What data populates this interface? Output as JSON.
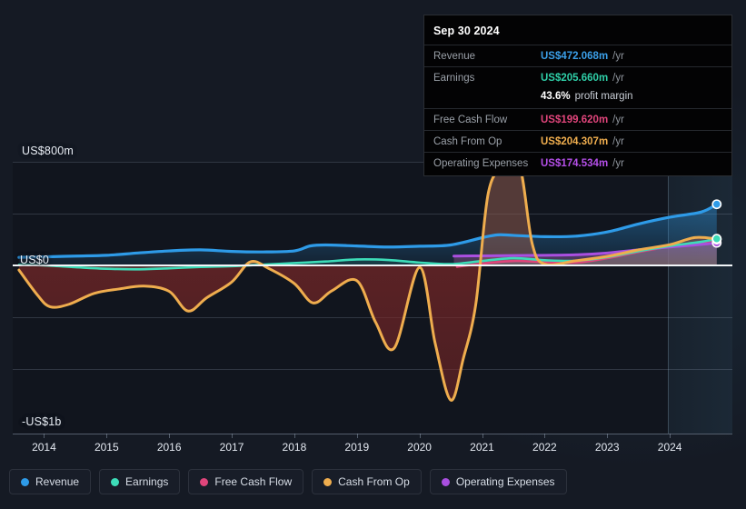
{
  "chart_data": {
    "type": "area",
    "title": "",
    "xlabel": "",
    "ylabel": "",
    "x_tick_labels": [
      "2014",
      "2015",
      "2016",
      "2017",
      "2018",
      "2019",
      "2020",
      "2021",
      "2022",
      "2023",
      "2024"
    ],
    "y_tick_labels": [
      "US$800m",
      "US$0",
      "-US$1b"
    ],
    "ylim": [
      -1150,
      900
    ],
    "xlim": [
      2013.5,
      2025.0
    ],
    "grid": true,
    "legend_position": "bottom-left",
    "currency": "USD",
    "units": "millions",
    "forecast_start_x": 2023.85,
    "series": [
      {
        "name": "Revenue",
        "color": "#2E9BE8",
        "x": [
          2013.6,
          2014.0,
          2014.5,
          2015.0,
          2015.5,
          2016.0,
          2016.5,
          2017.0,
          2017.5,
          2018.0,
          2018.25,
          2018.5,
          2019.0,
          2019.5,
          2020.0,
          2020.5,
          2021.0,
          2021.25,
          2021.5,
          2022.0,
          2022.5,
          2023.0,
          2023.5,
          2024.0,
          2024.5,
          2024.75
        ],
        "values": [
          62,
          66,
          72,
          78,
          96,
          112,
          120,
          108,
          104,
          112,
          150,
          158,
          150,
          142,
          148,
          158,
          214,
          236,
          232,
          222,
          226,
          258,
          320,
          372,
          412,
          472.068
        ]
      },
      {
        "name": "Earnings",
        "color": "#3DDCB8",
        "x": [
          2013.6,
          2014.0,
          2014.5,
          2015.0,
          2015.5,
          2016.0,
          2016.5,
          2017.0,
          2017.5,
          2018.0,
          2018.5,
          2019.0,
          2019.5,
          2020.0,
          2020.5,
          2021.0,
          2021.5,
          2022.0,
          2022.5,
          2023.0,
          2023.5,
          2024.0,
          2024.5,
          2024.75
        ],
        "values": [
          4,
          0,
          -14,
          -26,
          -30,
          -22,
          -12,
          -6,
          6,
          18,
          30,
          46,
          42,
          22,
          10,
          34,
          56,
          40,
          36,
          64,
          110,
          150,
          182,
          205.66
        ]
      },
      {
        "name": "Free Cash Flow",
        "color": "#E0457B",
        "x": [
          2020.6,
          2021.0,
          2021.5,
          2022.0,
          2022.5,
          2023.0,
          2023.5,
          2024.0,
          2024.5,
          2024.75
        ],
        "values": [
          -10,
          14,
          34,
          26,
          22,
          56,
          104,
          146,
          178,
          199.62
        ]
      },
      {
        "name": "Cash From Op",
        "color": "#EFAD4E",
        "x": [
          2013.6,
          2013.9,
          2014.1,
          2014.4,
          2014.8,
          2015.2,
          2015.6,
          2016.0,
          2016.3,
          2016.6,
          2017.0,
          2017.3,
          2017.6,
          2018.0,
          2018.3,
          2018.6,
          2019.0,
          2019.3,
          2019.6,
          2020.0,
          2020.25,
          2020.5,
          2020.7,
          2020.9,
          2021.1,
          2021.35,
          2021.6,
          2021.8,
          2022.0,
          2022.5,
          2023.0,
          2023.5,
          2024.0,
          2024.4,
          2024.75
        ],
        "values": [
          -36,
          -232,
          -320,
          -300,
          -216,
          -182,
          -160,
          -200,
          -352,
          -250,
          -128,
          28,
          -26,
          -140,
          -290,
          -196,
          -118,
          -440,
          -636,
          -16,
          -600,
          -1040,
          -720,
          -300,
          560,
          760,
          770,
          170,
          10,
          36,
          70,
          120,
          160,
          215,
          204.307
        ]
      },
      {
        "name": "Operating Expenses",
        "color": "#A94FE0",
        "x": [
          2020.55,
          2021.0,
          2021.5,
          2022.0,
          2022.5,
          2023.0,
          2023.5,
          2024.0,
          2024.5,
          2024.75
        ],
        "values": [
          72,
          74,
          76,
          78,
          82,
          96,
          120,
          142,
          162,
          174.534
        ]
      }
    ]
  },
  "tooltip": {
    "date": "Sep 30 2024",
    "rows": [
      {
        "label": "Revenue",
        "value": "US$472.068m",
        "unit": "/yr",
        "color": "#3B9FE8"
      },
      {
        "label": "Earnings",
        "value": "US$205.660m",
        "unit": "/yr",
        "color": "#2FCFA8"
      },
      {
        "label": "",
        "value": "43.6%",
        "unit": "",
        "margin": "profit margin",
        "color": "#FFFFFF"
      },
      {
        "label": "Free Cash Flow",
        "value": "US$199.620m",
        "unit": "/yr",
        "color": "#E0457B"
      },
      {
        "label": "Cash From Op",
        "value": "US$204.307m",
        "unit": "/yr",
        "color": "#EFAD4E"
      },
      {
        "label": "Operating Expenses",
        "value": "US$174.534m",
        "unit": "/yr",
        "color": "#B44FE8"
      }
    ]
  },
  "legend": {
    "items": [
      {
        "label": "Revenue",
        "color": "#2E9BE8"
      },
      {
        "label": "Earnings",
        "color": "#3DDCB8"
      },
      {
        "label": "Free Cash Flow",
        "color": "#E0457B"
      },
      {
        "label": "Cash From Op",
        "color": "#EFAD4E"
      },
      {
        "label": "Operating Expenses",
        "color": "#A94FE0"
      }
    ]
  },
  "axis": {
    "y_top_label": "US$800m",
    "y_zero_label": "US$0",
    "y_bottom_label": "-US$1b"
  }
}
